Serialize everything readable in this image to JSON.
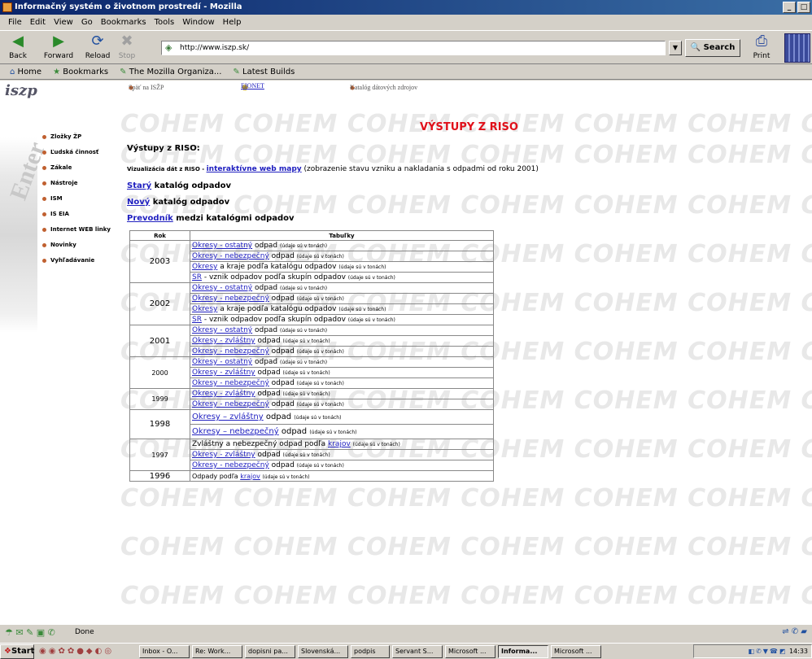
{
  "window": {
    "title": "Informačný systém o životnom prostredí - Mozilla",
    "min": "_",
    "max": "□",
    "close": "x"
  },
  "menu": [
    "File",
    "Edit",
    "View",
    "Go",
    "Bookmarks",
    "Tools",
    "Window",
    "Help"
  ],
  "toolbar": {
    "back": "Back",
    "forward": "Forward",
    "reload": "Reload",
    "stop": "Stop",
    "url": "http://www.iszp.sk/",
    "search": "Search",
    "print": "Print"
  },
  "personal": {
    "home": "Home",
    "bookmarks": "Bookmarks",
    "mozorg": "The Mozilla Organiza...",
    "builds": "Latest Builds"
  },
  "page": {
    "logo": "iszp",
    "topnav": [
      "Späť na ISŽP",
      "EIONET",
      "Katalóg dátových zdrojov"
    ],
    "sidenav": [
      "Zložky ŽP",
      "Ľudská činnosť",
      "Zákale",
      "Nástroje",
      "ISM",
      "IS EIA",
      "Internet WEB linky",
      "Novinky",
      "Vyhľadávanie"
    ],
    "title": "VÝSTUPY Z RISO",
    "heading": "Výstupy z RISO:",
    "viz_prefix": "Vizualizácia dát z RISO - ",
    "viz_link": "interaktívne web mapy",
    "viz_suffix": " (zobrazenie stavu vzniku a nakladania s odpadmi od roku 2001)",
    "stary_link": "Starý",
    "stary_rest": " katalóg odpadov",
    "novy_link": "Nový",
    "novy_rest": " katalóg odpadov",
    "prev_link": "Prevodník",
    "prev_rest": " medzi katalógmi odpadov",
    "watermark": "COHEM COHEM COHEM COHEM COHEM COHEM COHEM COHEM"
  },
  "table": {
    "col_year": "Rok",
    "col_tables": "Tabuľky",
    "unit": "(údaje sú v tonách)",
    "years": [
      "2003",
      "2002",
      "2001",
      "2000",
      "1999",
      "1998",
      "1997",
      "1996"
    ],
    "rows": [
      {
        "link": "Okresy - ostatný",
        "rest": " odpad "
      },
      {
        "link": "Okresy - nebezpečný",
        "rest": " odpad "
      },
      {
        "link": "Okresy",
        "rest": " a kraje podľa katalógu odpadov "
      },
      {
        "link": "SR",
        "rest": " - vznik odpadov podľa skupín odpadov "
      },
      {
        "link": "Okresy - ostatný",
        "rest": " odpad "
      },
      {
        "link": "Okresy - nebezpečný",
        "rest": " odpad "
      },
      {
        "link": "Okresy",
        "rest": " a kraje podľa katalógu odpadov "
      },
      {
        "link": "SR",
        "rest": " - vznik odpadov podľa skupín odpadov "
      },
      {
        "link": "Okresy - ostatný",
        "rest": " odpad "
      },
      {
        "link": "Okresy - zvláštny",
        "rest": " odpad "
      },
      {
        "link": "Okresy - nebezpečný",
        "rest": " odpad "
      },
      {
        "link": "Okresy - ostatný",
        "rest": " odpad "
      },
      {
        "link": "Okresy - zvláštny",
        "rest": " odpad "
      },
      {
        "link": "Okresy - nebezpečný",
        "rest": " odpad "
      },
      {
        "link": "Okresy - zvláštny",
        "rest": " odpad "
      },
      {
        "link": "Okresy - nebezpečný",
        "rest": " odpad "
      },
      {
        "link": "Okresy – zvláštny",
        "rest": " odpad "
      },
      {
        "link": "Okresy – nebezpečný",
        "rest": " odpad "
      },
      {
        "pre": "Zvláštny a nebezpečný odpad podľa ",
        "link": "krajov",
        "rest": " "
      },
      {
        "link": "Okresy - zvláštny",
        "rest": " odpad "
      },
      {
        "link": "Okresy - nebezpečný",
        "rest": " odpad "
      },
      {
        "pre": "Odpady podľa ",
        "link": "krajov",
        "rest": " "
      }
    ]
  },
  "status": {
    "text": "Done"
  },
  "taskbar": {
    "start": "Start",
    "tasks": [
      "Inbox - O...",
      "Re: Work...",
      "dopisni pa...",
      "Slovenská...",
      "podpis",
      "Servant S...",
      "Microsoft ...",
      "Informa...",
      "Microsoft ..."
    ],
    "clock": "14:33"
  }
}
